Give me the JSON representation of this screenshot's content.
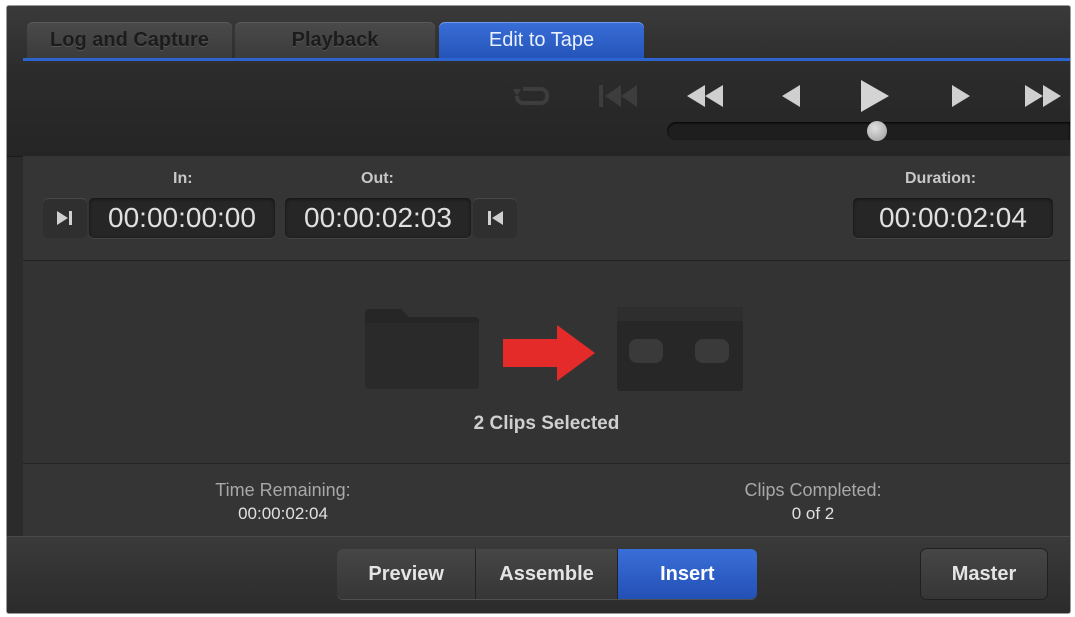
{
  "tabs": [
    {
      "label": "Log and Capture",
      "active": false
    },
    {
      "label": "Playback",
      "active": false
    },
    {
      "label": "Edit to Tape",
      "active": true
    }
  ],
  "transport": {
    "icons": [
      "loop-icon",
      "go-to-start-icon",
      "rewind-icon",
      "step-back-icon",
      "play-icon",
      "step-forward-icon",
      "fast-forward-icon"
    ],
    "jog_position": 0.52
  },
  "timecode": {
    "in_label": "In:",
    "in_value": "00:00:00:00",
    "out_label": "Out:",
    "out_value": "00:00:02:03",
    "duration_label": "Duration:",
    "duration_value": "00:00:02:04"
  },
  "graphic": {
    "clips_selected": "2 Clips Selected",
    "arrow_color": "#e52a2a"
  },
  "status": {
    "time_remaining_label": "Time Remaining:",
    "time_remaining_value": "00:00:02:04",
    "clips_completed_label": "Clips Completed:",
    "clips_completed_value": "0 of 2"
  },
  "modes": {
    "preview": "Preview",
    "assemble": "Assemble",
    "insert": "Insert",
    "active": "Insert"
  },
  "master_label": "Master",
  "colors": {
    "accent": "#2d64d0",
    "background": "#2b2b2b"
  }
}
